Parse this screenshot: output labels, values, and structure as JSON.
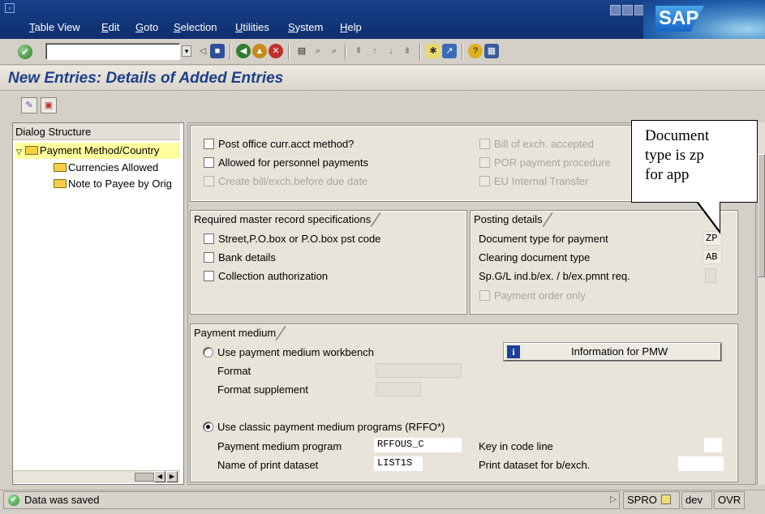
{
  "menu": {
    "items": [
      "Table View",
      "Edit",
      "Goto",
      "Selection",
      "Utilities",
      "System",
      "Help"
    ],
    "logo": "SAP"
  },
  "title": "New Entries: Details of Added Entries",
  "dialog_structure": {
    "header": "Dialog Structure",
    "items": [
      {
        "label": "Payment Method/Country",
        "selected": true
      },
      {
        "label": "Currencies Allowed"
      },
      {
        "label": "Note to Payee by Orig"
      }
    ]
  },
  "top_section": {
    "left": [
      {
        "label": "Post office curr.acct method?",
        "enabled": true,
        "checked": false
      },
      {
        "label": "Allowed for personnel payments",
        "enabled": true,
        "checked": false
      },
      {
        "label": "Create bill/exch.before due date",
        "enabled": false,
        "checked": false
      }
    ],
    "right": [
      {
        "label": "Bill of exch. accepted",
        "enabled": false
      },
      {
        "label": "POR payment procedure",
        "enabled": false
      },
      {
        "label": "EU Internal Transfer",
        "enabled": false
      }
    ]
  },
  "required_master": {
    "title": "Required master record specifications",
    "items": [
      "Street,P.O.box or P.O.box pst code",
      "Bank details",
      "Collection authorization"
    ]
  },
  "posting_details": {
    "title": "Posting details",
    "document_type_label": "Document type for payment",
    "document_type_value": "ZP",
    "clearing_label": "Clearing document type",
    "clearing_value": "AB",
    "spgl_label": "Sp.G/L ind.b/ex. / b/ex.pmnt req.",
    "spgl_value": "",
    "payment_order_only": "Payment order only"
  },
  "payment_medium": {
    "title": "Payment medium",
    "pmw_radio": "Use payment medium workbench",
    "format_label": "Format",
    "format_supplement_label": "Format supplement",
    "pmw_button": "Information for PMW",
    "classic_radio": "Use classic payment medium programs (RFFO*)",
    "program_label": "Payment medium program",
    "program_value": "RFFOUS_C",
    "print_dataset_label": "Name of print dataset",
    "print_dataset_value": "LIST1S",
    "key_in_code_line_label": "Key in code line",
    "print_dataset_bexch_label": "Print dataset for b/exch."
  },
  "callout": {
    "lines": [
      "Document",
      "type is zp",
      "for app"
    ]
  },
  "status": {
    "message": "Data was saved",
    "transaction": "SPRO",
    "system": "dev",
    "mode": "OVR"
  },
  "colors": {
    "menubar": "#19408a",
    "title_text": "#1d3f8a",
    "selected_tree": "#ffff9e",
    "panel": "#e9e4da"
  }
}
